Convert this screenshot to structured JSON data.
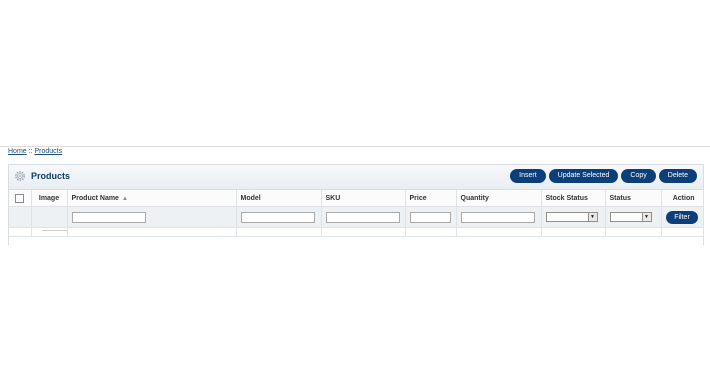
{
  "breadcrumb": {
    "home": "Home",
    "separator": " :: ",
    "current": "Products"
  },
  "panel": {
    "title": "Products",
    "icon": "gear-icon",
    "buttons": {
      "insert": "Insert",
      "update_selected": "Update Selected",
      "copy": "Copy",
      "delete": "Delete"
    }
  },
  "table": {
    "headers": {
      "image": "Image",
      "product_name": "Product Name",
      "model": "Model",
      "sku": "SKU",
      "price": "Price",
      "quantity": "Quantity",
      "stock_status": "Stock Status",
      "status": "Status",
      "action": "Action"
    },
    "sort_indicator": "▲",
    "filter_button": "Filter",
    "filters": {
      "product_name": "",
      "model": "",
      "sku": "",
      "price": "",
      "quantity": "",
      "stock_status": "",
      "status": ""
    }
  },
  "colors": {
    "accent": "#0c3f7a",
    "title": "#0a3d6e",
    "link": "#1d4f7a"
  }
}
